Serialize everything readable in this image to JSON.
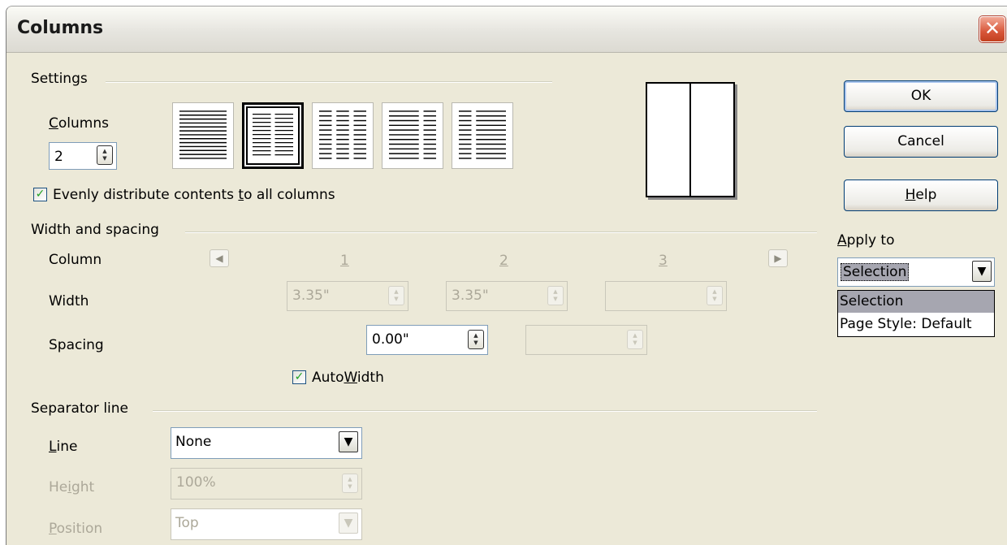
{
  "window": {
    "title": "Columns",
    "close_glyph": "✕"
  },
  "settings": {
    "group_label": "Settings",
    "columns_label": "Columns",
    "columns_value": "2",
    "presets": [
      "1 column",
      "2 columns",
      "3 columns",
      "2 columns left wide",
      "2 columns right wide"
    ],
    "selected_preset": 1,
    "evenly_label": "Evenly distribute contents to all columns",
    "evenly_checked": true
  },
  "width_spacing": {
    "group_label": "Width and spacing",
    "column_label": "Column",
    "width_label": "Width",
    "spacing_label": "Spacing",
    "col_headers": [
      "1",
      "2",
      "3"
    ],
    "widths": [
      "3.35\"",
      "3.35\"",
      ""
    ],
    "spacings": [
      "0.00\"",
      ""
    ],
    "autowidth_label": "AutoWidth",
    "autowidth_checked": true,
    "prev_icon": "arrow-left-icon",
    "next_icon": "arrow-right-icon"
  },
  "separator": {
    "group_label": "Separator line",
    "line_label": "Line",
    "line_value": "None",
    "height_label": "Height",
    "height_value": "100%",
    "position_label": "Position",
    "position_value": "Top"
  },
  "buttons": {
    "ok": "OK",
    "cancel": "Cancel",
    "help": "Help"
  },
  "apply_to": {
    "label": "Apply to",
    "selected": "Selection",
    "options": [
      "Selection",
      "Page Style: Default"
    ]
  },
  "colors": {
    "dialog_bg": "#ece9d8",
    "highlight": "#a6a6b0",
    "check": "#21a121",
    "close": "#d8573a"
  }
}
